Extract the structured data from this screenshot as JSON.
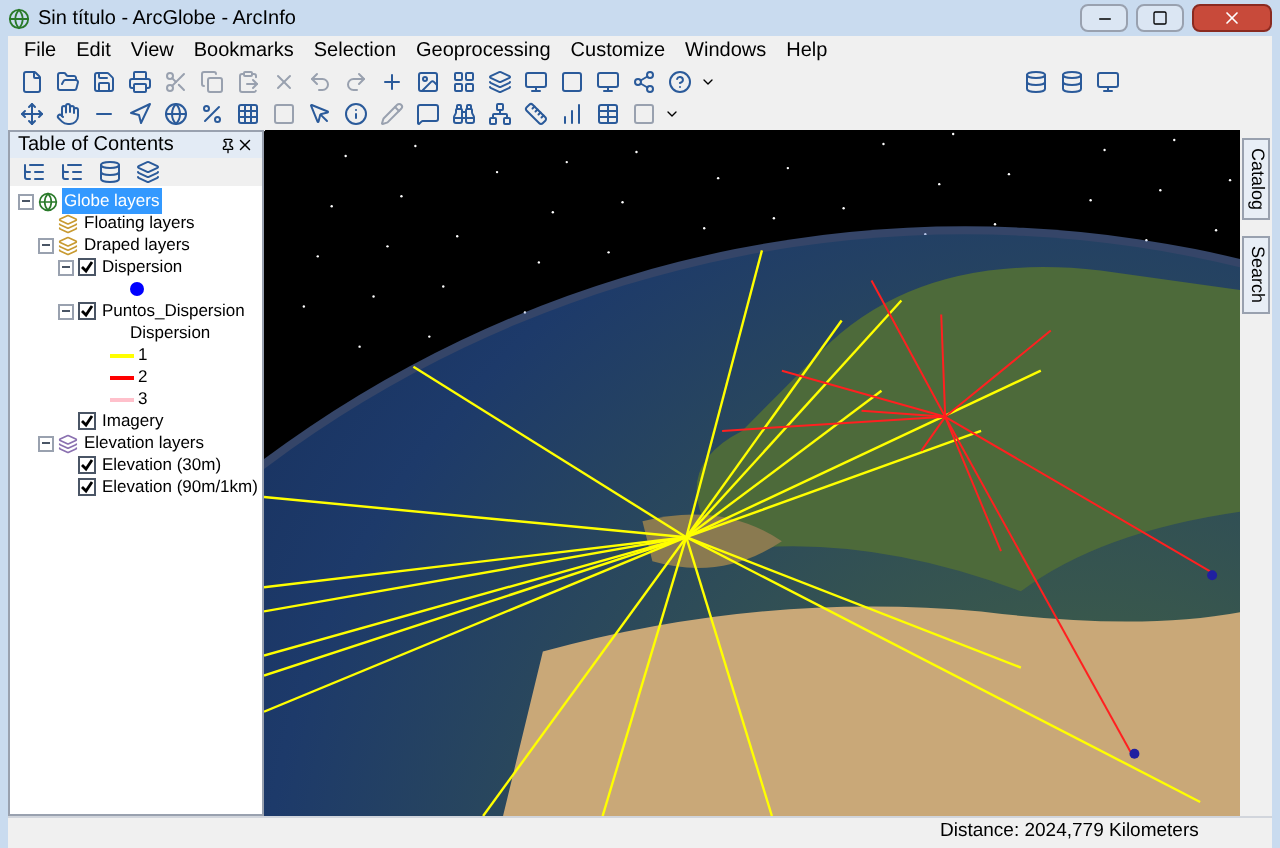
{
  "window": {
    "title": "Sin título - ArcGlobe - ArcInfo"
  },
  "menu": [
    "File",
    "Edit",
    "View",
    "Bookmarks",
    "Selection",
    "Geoprocessing",
    "Customize",
    "Windows",
    "Help"
  ],
  "toc": {
    "title": "Table of Contents",
    "tree": [
      {
        "label": "Globe layers",
        "kind": "globe",
        "selected": true,
        "expanded": true,
        "children": [
          {
            "label": "Floating layers",
            "kind": "group",
            "selected": false
          },
          {
            "label": "Draped layers",
            "kind": "group",
            "selected": false,
            "expanded": true,
            "children": [
              {
                "label": "Dispersion",
                "kind": "layer",
                "selected": false,
                "checked": true,
                "expanded": true,
                "children": [
                  {
                    "kind": "point",
                    "color": "#0000ff"
                  }
                ]
              },
              {
                "label": "Puntos_Dispersion",
                "kind": "layer",
                "selected": false,
                "checked": true,
                "expanded": true,
                "children": [
                  {
                    "kind": "heading",
                    "label": "Dispersion"
                  },
                  {
                    "kind": "line",
                    "label": "1",
                    "color": "#ffff00"
                  },
                  {
                    "kind": "line",
                    "label": "2",
                    "color": "#ff0000"
                  },
                  {
                    "kind": "line",
                    "label": "3",
                    "color": "#ffc0cb"
                  }
                ]
              },
              {
                "label": "Imagery",
                "kind": "layer",
                "selected": false,
                "checked": true
              }
            ]
          },
          {
            "label": "Elevation layers",
            "kind": "elevation",
            "selected": false,
            "expanded": true,
            "children": [
              {
                "label": "Elevation (30m)",
                "kind": "layer",
                "selected": false,
                "checked": true
              },
              {
                "label": "Elevation (90m/1km)",
                "kind": "layer",
                "selected": false,
                "checked": true
              }
            ]
          }
        ]
      }
    ]
  },
  "side_tabs": [
    "Catalog",
    "Search"
  ],
  "status_bar": {
    "distance": "Distance: 2024,779 Kilometers"
  }
}
